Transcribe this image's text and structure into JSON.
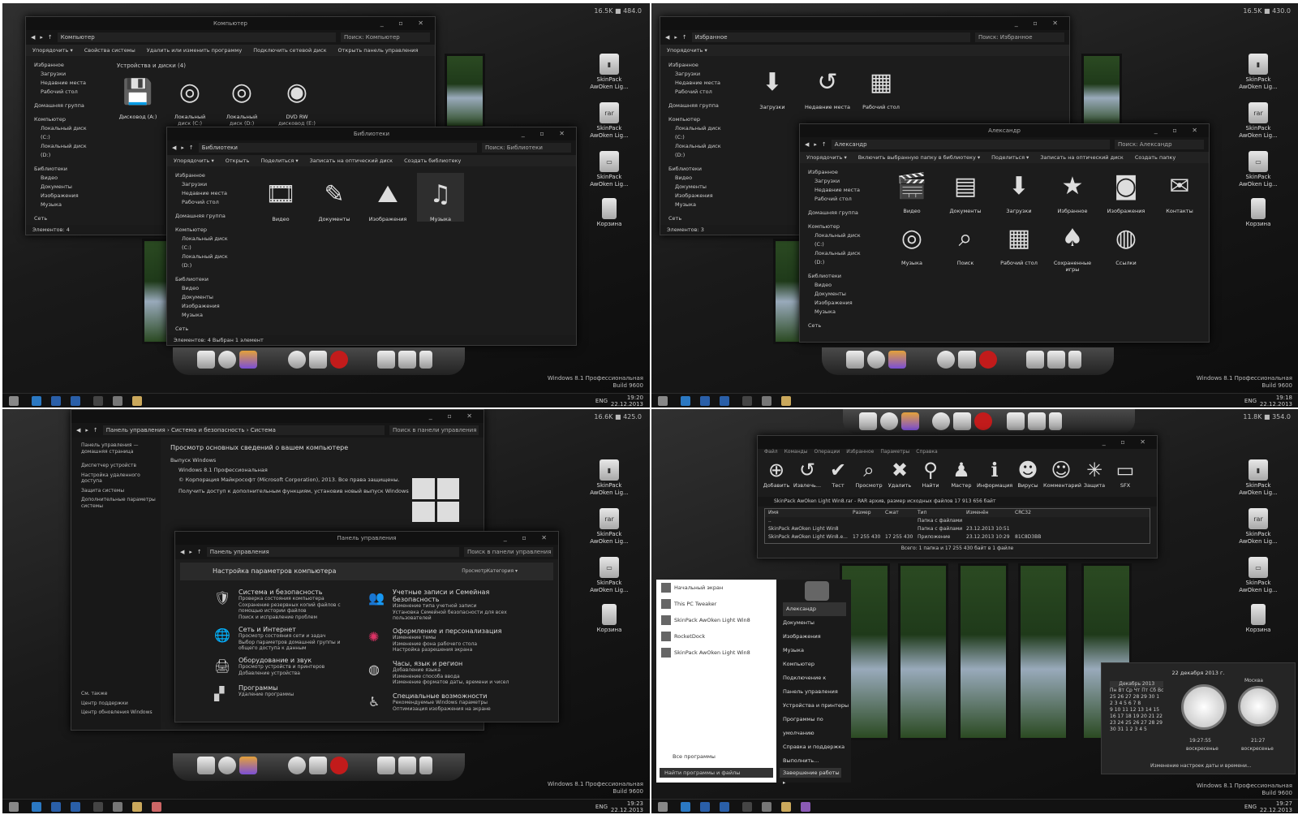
{
  "q1": {
    "stat": "16.5K ■ 484.0",
    "desktop": {
      "skin1": "SkinPack AwOken Lig...",
      "skin2": "SkinPack AwOken Lig...",
      "skin3": "SkinPack AwOken Lig...",
      "recycle": "Корзина",
      "rar": "rar"
    },
    "computer_window": {
      "title": "Компьютер",
      "path": "Компьютер",
      "search": "Поиск: Компьютер",
      "ribbon": [
        "Упорядочить ▾",
        "Свойства системы",
        "Удалить или изменить программу",
        "Подключить сетевой диск",
        "Открыть панель управления"
      ],
      "group": "Устройства и диски (4)",
      "drives": [
        {
          "label": "Дисковод (A:)",
          "glyph": "💾"
        },
        {
          "label": "Локальный диск (C:)",
          "glyph": "◎"
        },
        {
          "label": "Локальный диск (D:)",
          "glyph": "◎"
        },
        {
          "label": "DVD RW дисковод (E:)",
          "glyph": "◉"
        }
      ],
      "nav": [
        "Избранное",
        "Загрузки",
        "Недавние места",
        "Рабочий стол",
        "Домашняя группа",
        "Компьютер",
        "Локальный диск (C:)",
        "Локальный диск (D:)",
        "Библиотеки",
        "Видео",
        "Документы",
        "Изображения",
        "Музыка",
        "Сеть"
      ],
      "status": "Элементов: 4"
    },
    "libraries_window": {
      "title": "Библиотеки",
      "path": "Библиотеки",
      "search": "Поиск: Библиотеки",
      "ribbon": [
        "Упорядочить ▾",
        "Открыть",
        "Поделиться ▾",
        "Записать на оптический диск",
        "Создать библиотеку"
      ],
      "items": [
        {
          "label": "Видео",
          "glyph": "🎞"
        },
        {
          "label": "Документы",
          "glyph": "✎"
        },
        {
          "label": "Изображения",
          "glyph": "⛰"
        },
        {
          "label": "Музыка",
          "glyph": "♫"
        }
      ],
      "nav": [
        "Избранное",
        "Загрузки",
        "Недавние места",
        "Рабочий стол",
        "Домашняя группа",
        "Компьютер",
        "Локальный диск (C:)",
        "Локальный диск (D:)",
        "Библиотеки",
        "Видео",
        "Документы",
        "Изображения",
        "Музыка",
        "Сеть"
      ],
      "status": "Элементов: 4    Выбран 1 элемент"
    },
    "winver": "Windows 8.1 Профессиональная\nBuild 9600",
    "lang": "ENG",
    "time": "19:20",
    "date": "22.12.2013"
  },
  "q2": {
    "stat": "16.5K ■ 430.0",
    "fav_window": {
      "path": "Избранное",
      "search": "Поиск: Избранное",
      "ribbon": [
        "Упорядочить ▾"
      ],
      "items": [
        {
          "label": "Загрузки",
          "glyph": "⬇"
        },
        {
          "label": "Недавние места",
          "glyph": "↺"
        },
        {
          "label": "Рабочий стол",
          "glyph": "▦"
        }
      ],
      "nav": [
        "Избранное",
        "Загрузки",
        "Недавние места",
        "Рабочий стол",
        "Домашняя группа",
        "Компьютер",
        "Локальный диск (C:)",
        "Локальный диск (D:)",
        "Библиотеки",
        "Видео",
        "Документы",
        "Изображения",
        "Музыка",
        "Сеть"
      ],
      "status": "Элементов: 3"
    },
    "user_window": {
      "title": "Александр",
      "path": "Александр",
      "search": "Поиск: Александр",
      "ribbon": [
        "Упорядочить ▾",
        "Включить выбранную папку в библиотеку ▾",
        "Поделиться ▾",
        "Записать на оптический диск",
        "Создать папку"
      ],
      "items": [
        {
          "label": "Видео",
          "glyph": "🎬"
        },
        {
          "label": "Документы",
          "glyph": "▤"
        },
        {
          "label": "Загрузки",
          "glyph": "⬇"
        },
        {
          "label": "Избранное",
          "glyph": "★"
        },
        {
          "label": "Изображения",
          "glyph": "◙"
        },
        {
          "label": "Контакты",
          "glyph": "✉"
        },
        {
          "label": "Музыка",
          "glyph": "◎"
        },
        {
          "label": "Поиск",
          "glyph": "⌕"
        },
        {
          "label": "Рабочий стол",
          "glyph": "▦"
        },
        {
          "label": "Сохраненные игры",
          "glyph": "♠"
        },
        {
          "label": "Ссылки",
          "glyph": "◍"
        }
      ],
      "nav": [
        "Избранное",
        "Загрузки",
        "Недавние места",
        "Рабочий стол",
        "Домашняя группа",
        "Компьютер",
        "Локальный диск (C:)",
        "Локальный диск (D:)",
        "Библиотеки",
        "Видео",
        "Документы",
        "Изображения",
        "Музыка",
        "Сеть"
      ]
    },
    "winver": "Windows 8.1 Профессиональная\nBuild 9600",
    "lang": "ENG",
    "time": "19:18",
    "date": "22.12.2013"
  },
  "q3": {
    "stat": "16.6K ■ 425.0",
    "system_window": {
      "path": "Панель управления › Система и безопасность › Система",
      "search": "Поиск в панели управления",
      "side_title": "Панель управления — домашняя страница",
      "side_links": [
        "Диспетчер устройств",
        "Настройка удаленного доступа",
        "Защита системы",
        "Дополнительные параметры системы"
      ],
      "side_bottom": [
        "См. также",
        "Центр поддержки",
        "Центр обновления Windows"
      ],
      "heading": "Просмотр основных сведений о вашем компьютере",
      "edition_h": "Выпуск Windows",
      "edition": "Windows 8.1 Профессиональная",
      "copyright": "© Корпорация Майкрософт (Microsoft Corporation), 2013. Все права защищены.",
      "more": "Получить доступ к дополнительным функциям, установив новый выпуск Windows"
    },
    "cp_window": {
      "title": "Панель управления",
      "path": "Панель управления",
      "search": "Поиск в панели управления",
      "heading": "Настройка параметров компьютера",
      "view_label": "Просмотр:",
      "view_value": "Категория ▾",
      "left": [
        {
          "title": "Система и безопасность",
          "links": "Проверка состояния компьютера\nСохранение резервных копий файлов с помощью истории файлов\nПоиск и исправление проблем",
          "glyph": "🛡"
        },
        {
          "title": "Сеть и Интернет",
          "links": "Просмотр состояния сети и задач\nВыбор параметров домашней группы и общего доступа к данным",
          "glyph": "🌐"
        },
        {
          "title": "Оборудование и звук",
          "links": "Просмотр устройств и принтеров\nДобавление устройства",
          "glyph": "🖨"
        },
        {
          "title": "Программы",
          "links": "Удаление программы",
          "glyph": "▞"
        }
      ],
      "right": [
        {
          "title": "Учетные записи и Семейная безопасность",
          "links": "Изменение типа учетной записи\nУстановка Семейной безопасности для всех пользователей",
          "glyph": "👥"
        },
        {
          "title": "Оформление и персонализация",
          "links": "Изменение темы\nИзменение фона рабочего стола\nНастройка разрешения экрана",
          "glyph": "✺"
        },
        {
          "title": "Часы, язык и регион",
          "links": "Добавление языка\nИзменение способа ввода\nИзменение форматов даты, времени и чисел",
          "glyph": "◍"
        },
        {
          "title": "Специальные возможности",
          "links": "Рекомендуемые Windows параметры\nОптимизация изображения на экране",
          "glyph": "♿"
        }
      ]
    },
    "winver": "Windows 8.1 Профессиональная\nBuild 9600",
    "lang": "ENG",
    "time": "19:23",
    "date": "22.12.2013"
  },
  "q4": {
    "stat": "11.8K ■ 354.0",
    "winrar": {
      "menu": [
        "Файл",
        "Команды",
        "Операции",
        "Избранное",
        "Параметры",
        "Справка"
      ],
      "tools": [
        {
          "label": "Добавить",
          "glyph": "⊕"
        },
        {
          "label": "Извлечь...",
          "glyph": "↺"
        },
        {
          "label": "Тест",
          "glyph": "✔"
        },
        {
          "label": "Просмотр",
          "glyph": "⌕"
        },
        {
          "label": "Удалить",
          "glyph": "✖"
        },
        {
          "label": "Найти",
          "glyph": "⚲"
        },
        {
          "label": "Мастер",
          "glyph": "♟"
        },
        {
          "label": "Информация",
          "glyph": "ℹ"
        },
        {
          "label": "Вирусы",
          "glyph": "☻"
        },
        {
          "label": "Комментарий",
          "glyph": "☺"
        },
        {
          "label": "Защита",
          "glyph": "✳"
        },
        {
          "label": "SFX",
          "glyph": "▭"
        }
      ],
      "path": "SkinPack AwOken Light Win8.rar - RAR архив, размер исходных файлов 17 913 656 байт",
      "headers": [
        "Имя",
        "Размер",
        "Сжат",
        "Тип",
        "Изменён",
        "CRC32"
      ],
      "rows": [
        [
          "..",
          "",
          "",
          "Папка с файлами",
          "",
          ""
        ],
        [
          "SkinPack AwOken Light Win8",
          "",
          "",
          "Папка с файлами",
          "23.12.2013 10:51",
          ""
        ],
        [
          "SkinPack AwOken Light Win8.e...",
          "17 255 430",
          "17 255 430",
          "Приложение",
          "23.12.2013 10:29",
          "81C8D3BB"
        ]
      ],
      "status": "Всего: 1 папка и 17 255 430 байт в 1 файле"
    },
    "start_items": [
      "Начальный экран",
      "This PC Tweaker",
      "SkinPack AwOken Light Win8",
      "RocketDock",
      "SkinPack AwOken Light Win8"
    ],
    "all_programs": "Все программы",
    "search": "Найти программы и файлы",
    "right_items": [
      "Александр",
      "Документы",
      "Изображения",
      "Музыка",
      "Компьютер",
      "Подключение к",
      "Панель управления",
      "Устройства и принтеры",
      "Программы по умолчанию",
      "Справка и поддержка",
      "Выполнить..."
    ],
    "shutdown": "Завершение работы ▸",
    "clock_widget": {
      "date_title": "22 декабря 2013 г.",
      "month": "Декабрь 2013",
      "weekdays": "Пн Вт Ср Чт Пт Сб Вс",
      "weeks": [
        "25 26 27 28 29 30 1",
        "2 3 4 5 6 7 8",
        "9 10 11 12 13 14 15",
        "16 17 18 19 20 21 22",
        "23 24 25 26 27 28 29",
        "30 31 1 2 3 4 5"
      ],
      "clock1_time": "19:27:55",
      "clock1_day": "воскресенье",
      "clock2_city": "Москва",
      "clock2_time": "21:27",
      "clock2_day": "воскресенье",
      "link": "Изменение настроек даты и времени..."
    },
    "winver": "Windows 8.1 Профессиональная\nBuild 9600",
    "lang": "ENG",
    "time": "19:27",
    "date": "22.12.2013"
  }
}
